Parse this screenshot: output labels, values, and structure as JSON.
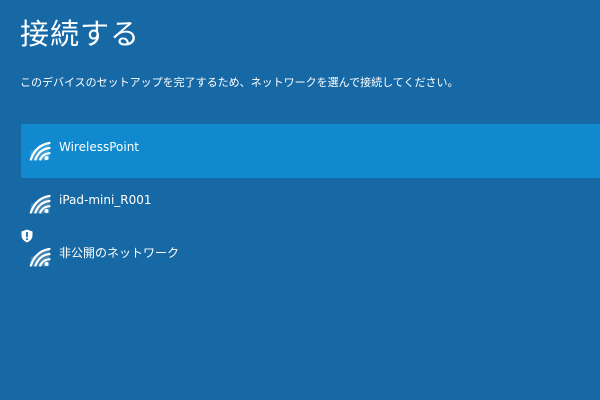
{
  "title": "接続する",
  "instruction": "このデバイスのセットアップを完了するため、ネットワークを選んで接続してください。",
  "networks": [
    {
      "name": "WirelessPoint",
      "icon": "wifi-icon",
      "selected": true
    },
    {
      "name": "iPad-mini_R001",
      "icon": "wifi-icon",
      "selected": false
    },
    {
      "name": "非公開のネットワーク",
      "icon": "wifi-secured-warning-icon",
      "selected": false
    }
  ],
  "colors": {
    "background": "#1769a6",
    "selected_item": "#1189cf",
    "text": "#ffffff"
  }
}
